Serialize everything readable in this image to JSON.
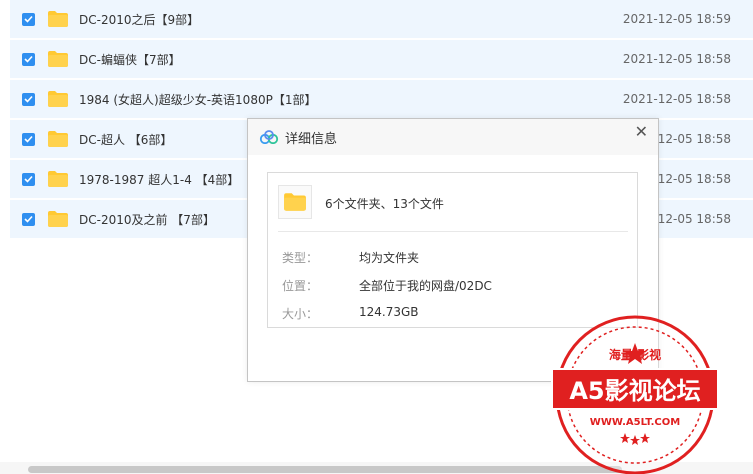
{
  "files": [
    {
      "name": "DC-2010之后【9部】",
      "date": "2021-12-05 18:59"
    },
    {
      "name": "DC-蝙蝠侠【7部】",
      "date": "2021-12-05 18:58"
    },
    {
      "name": "1984 (女超人)超级少女-英语1080P【1部】",
      "date": "2021-12-05 18:58"
    },
    {
      "name": "DC-超人 【6部】",
      "date": "12-05 18:58"
    },
    {
      "name": "1978-1987 超人1-4 【4部】",
      "date": "12-05 18:58"
    },
    {
      "name": "DC-2010及之前 【7部】",
      "date": "12-05 18:58"
    }
  ],
  "dialog": {
    "title": "详细信息",
    "close": "✕",
    "summary": "6个文件夹、13个文件",
    "type_label": "类型：",
    "type_value": "均为文件夹",
    "location_label": "位置：",
    "location_value": "全部位于我的网盘/02DC",
    "size_label": "大小：",
    "size_value": "124.73GB"
  },
  "watermark": {
    "top_text": "海量 影视",
    "main_text": "A5影视论坛",
    "url": "WWW.A5LT.COM"
  },
  "colors": {
    "checkbox": "#2f8ff0",
    "row_bg": "#eef6fe",
    "folder": "#ffc933",
    "stamp_red": "#e02020"
  },
  "icons": [
    "checkbox-checked-icon",
    "folder-icon",
    "cloud-icon",
    "close-icon"
  ]
}
